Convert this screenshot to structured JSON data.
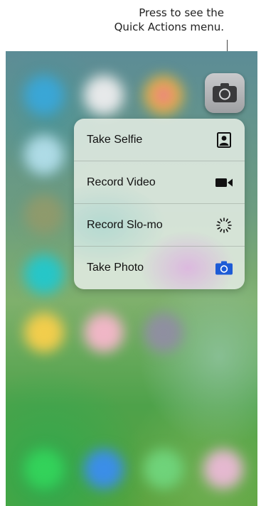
{
  "caption": {
    "line1": "Press to see the",
    "line2": "Quick Actions menu."
  },
  "app_icon": {
    "icon": "camera-icon",
    "color": "#a8aaad"
  },
  "quick_actions": [
    {
      "label": "Take Selfie",
      "icon": "selfie-portrait-icon",
      "color": "#111111"
    },
    {
      "label": "Record Video",
      "icon": "video-camera-icon",
      "color": "#111111"
    },
    {
      "label": "Record Slo-mo",
      "icon": "slo-mo-icon",
      "color": "#111111"
    },
    {
      "label": "Take Photo",
      "icon": "camera-icon",
      "color": "#1d5bd6"
    }
  ]
}
